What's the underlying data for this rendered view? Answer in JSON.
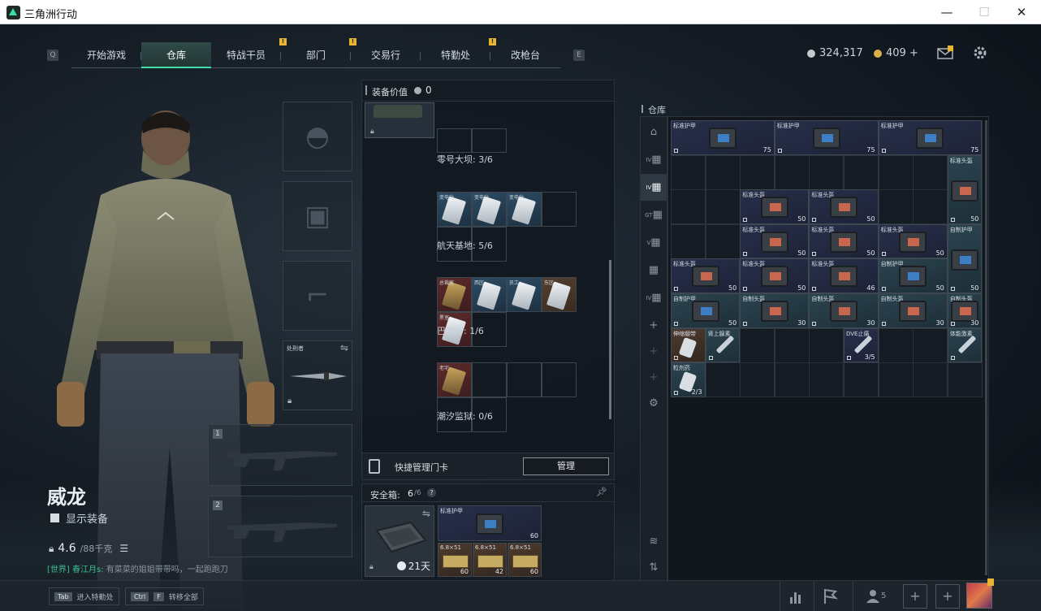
{
  "window": {
    "title": "三角洲行动",
    "min": "—",
    "max": "☐",
    "close": "✕"
  },
  "nav": {
    "left_key": "Q",
    "right_key": "E",
    "tabs": [
      {
        "label": "开始游戏",
        "badge": ""
      },
      {
        "label": "仓库",
        "badge": ""
      },
      {
        "label": "特战干员",
        "badge": "!"
      },
      {
        "label": "部门",
        "badge": "!"
      },
      {
        "label": "交易行",
        "badge": ""
      },
      {
        "label": "特勤处",
        "badge": "!"
      },
      {
        "label": "改枪台",
        "badge": ""
      }
    ],
    "active_tab": "仓库"
  },
  "currency": {
    "silver": "324,317",
    "gold": "409 +",
    "silver_color": "#c4c9ce",
    "gold_color": "#d9b04a"
  },
  "mail_badge": "!",
  "equipment": {
    "melee_label": "处刑者",
    "weapon_slot_1": "1",
    "weapon_slot_2": "2"
  },
  "player": {
    "name": "威龙",
    "show_gear": "显示装备",
    "weight": "4.6",
    "weight_max": "/88千克",
    "chat_channel": "[世界]",
    "chat_user": "春江月s:",
    "chat_msg": "有菜菜的姐姐带带吗，一起跑跑刀"
  },
  "keycards": {
    "header": "装备价值",
    "header_value": "0",
    "zones": [
      {
        "label": "零号大坝: 3/6",
        "cards": [
          {
            "name": "变电站",
            "color": "blue",
            "gold": false
          },
          {
            "name": "变电站",
            "color": "blue",
            "gold": false
          },
          {
            "name": "变电站",
            "color": "blue",
            "gold": false
          }
        ]
      },
      {
        "label": "航天基地: 5/6",
        "cards": [
          {
            "name": "总裁室",
            "color": "red",
            "gold": true
          },
          {
            "name": "西区",
            "color": "blue",
            "gold": false
          },
          {
            "name": "员工",
            "color": "blue",
            "gold": false
          },
          {
            "name": "东区",
            "color": "brown",
            "gold": false
          },
          {
            "name": "黑室",
            "color": "red",
            "gold": false
          }
        ]
      },
      {
        "label": "巴克什: 1/6",
        "cards": [
          {
            "name": "老宅",
            "color": "red",
            "gold": true
          }
        ]
      },
      {
        "label": "潮汐监狱: 0/6",
        "cards": []
      }
    ]
  },
  "quick_manage": {
    "label": "快捷管理门卡",
    "button": "管理"
  },
  "safe_box": {
    "label": "安全箱:",
    "capacity": "6",
    "capacity_max": "/6",
    "days": "21天",
    "vest_name": "标准护甲",
    "vest_dur": "60",
    "ammo": [
      {
        "name": "6.8×51",
        "count": "60"
      },
      {
        "name": "6.8×51",
        "count": "42"
      },
      {
        "name": "6.8×51",
        "count": "60"
      }
    ]
  },
  "warehouse": {
    "label": "仓库",
    "sidebar": [
      "仓库",
      "IV",
      "IV",
      "GT",
      "V",
      "",
      "IV",
      "+",
      "+",
      "+",
      "设置"
    ],
    "items": [
      {
        "name": "标准护甲",
        "dur": "75",
        "style": "dk",
        "kind": "vest"
      },
      {
        "name": "标准护甲",
        "dur": "75",
        "style": "dk",
        "kind": "vest"
      },
      {
        "name": "标准护甲",
        "dur": "75",
        "style": "dk",
        "kind": "vest"
      },
      {
        "name": "标准头盔",
        "dur": "50",
        "style": "tl",
        "kind": "helm"
      },
      {
        "name": "标准头盔",
        "dur": "50",
        "style": "dk",
        "kind": "helm"
      },
      {
        "name": "标准头盔",
        "dur": "50",
        "style": "dk",
        "kind": "helm"
      },
      {
        "name": "标准头盔",
        "dur": "50",
        "style": "dk",
        "kind": "helm"
      },
      {
        "name": "标准头盔",
        "dur": "50",
        "style": "dk",
        "kind": "helm"
      },
      {
        "name": "标准头盔",
        "dur": "50",
        "style": "dk",
        "kind": "helm"
      },
      {
        "name": "自制护甲",
        "dur": "50",
        "style": "tl",
        "kind": "vest"
      },
      {
        "name": "标准头盔",
        "dur": "50",
        "style": "dk",
        "kind": "helm"
      },
      {
        "name": "标准头盔",
        "dur": "50",
        "style": "dk",
        "kind": "helm"
      },
      {
        "name": "标准头盔",
        "dur": "46",
        "style": "dk",
        "kind": "helm"
      },
      {
        "name": "自制护甲",
        "dur": "50",
        "style": "tl",
        "kind": "vest"
      },
      {
        "name": "自制护甲",
        "dur": "50",
        "style": "tl",
        "kind": "vest"
      },
      {
        "name": "自制头盔",
        "dur": "30",
        "style": "tl",
        "kind": "helm"
      },
      {
        "name": "自制头盔",
        "dur": "30",
        "style": "tl",
        "kind": "helm"
      },
      {
        "name": "自制头盔",
        "dur": "30",
        "style": "tl",
        "kind": "helm"
      },
      {
        "name": "自制头盔",
        "dur": "30",
        "style": "tl",
        "kind": "helm"
      },
      {
        "name": "伸缩绷带",
        "dur": "",
        "style": "br",
        "kind": "med"
      },
      {
        "name": "伸缩绷带",
        "dur": "",
        "style": "br",
        "kind": "med"
      },
      {
        "name": "肾上腺素",
        "dur": "",
        "style": "tl",
        "kind": "syr"
      },
      {
        "name": "DVE止痛",
        "dur": "3/5",
        "style": "dk",
        "kind": "syr"
      },
      {
        "name": "体能激素",
        "dur": "",
        "style": "tl",
        "kind": "syr"
      },
      {
        "name": "粒剂药",
        "dur": "2/3",
        "style": "tl",
        "kind": "med"
      }
    ]
  },
  "bottom": {
    "tab_key": "Tab",
    "tab_label": "进入特勤处",
    "ctrl_key": "Ctrl",
    "f_key": "F",
    "ctrl_label": "转移全部",
    "friends": "5"
  }
}
